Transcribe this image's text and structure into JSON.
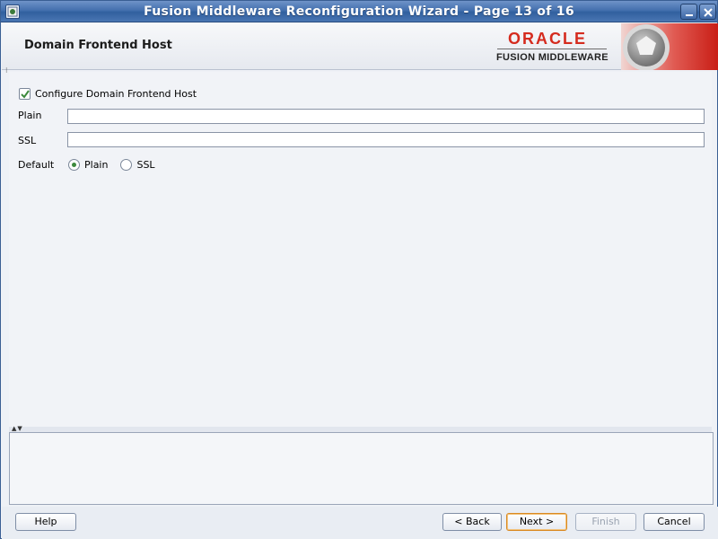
{
  "window": {
    "title": "Fusion Middleware Reconfiguration Wizard - Page 13 of 16",
    "icon": "app-icon",
    "controls": [
      "minimize-icon",
      "close-icon"
    ]
  },
  "header": {
    "title": "Domain Frontend Host",
    "brand_name": "ORACLE",
    "brand_product": "FUSION MIDDLEWARE",
    "brand_color": "#d52b1e"
  },
  "form": {
    "configure_checkbox": {
      "label": "Configure Domain Frontend Host",
      "checked": true
    },
    "plain": {
      "label": "Plain",
      "value": ""
    },
    "ssl": {
      "label": "SSL",
      "value": ""
    },
    "default": {
      "label": "Default",
      "options": [
        "Plain",
        "SSL"
      ],
      "selected": "Plain"
    }
  },
  "footer": {
    "help": "Help",
    "back": "< Back",
    "next": "Next >",
    "finish": "Finish",
    "cancel": "Cancel"
  },
  "colors": {
    "titlebar": "#4470ae",
    "focus_border": "#d98a23",
    "radio_selected": "#3d8a3d"
  }
}
